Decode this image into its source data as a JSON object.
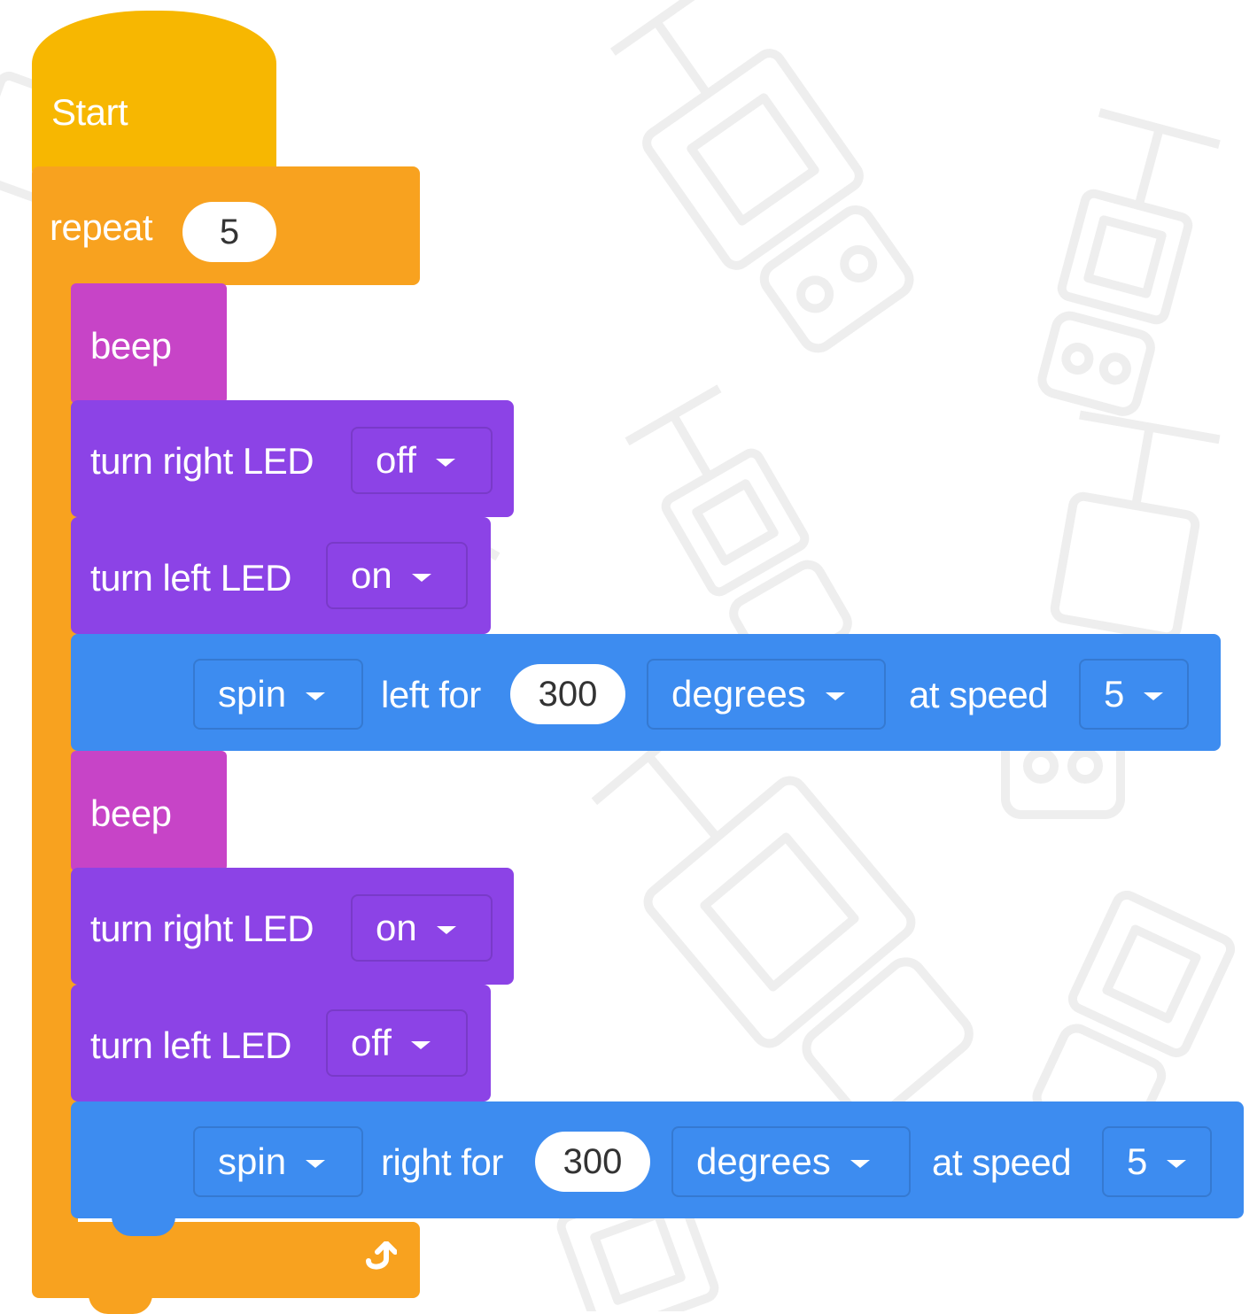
{
  "start": {
    "label": "Start"
  },
  "repeat": {
    "label": "repeat",
    "count": "5",
    "loop_icon": "repeat-arrow-icon"
  },
  "body": [
    {
      "kind": "beep",
      "label": "beep"
    },
    {
      "kind": "led",
      "label": "turn right LED",
      "value": "off"
    },
    {
      "kind": "led",
      "label": "turn left LED",
      "value": "on"
    },
    {
      "kind": "spin",
      "mode": "spin",
      "direction_label": "left for",
      "amount": "300",
      "unit": "degrees",
      "speed_label": "at speed",
      "speed": "5"
    },
    {
      "kind": "beep",
      "label": "beep"
    },
    {
      "kind": "led",
      "label": "turn right LED",
      "value": "on"
    },
    {
      "kind": "led",
      "label": "turn left LED",
      "value": "off"
    },
    {
      "kind": "spin",
      "mode": "spin",
      "direction_label": "right for",
      "amount": "300",
      "unit": "degrees",
      "speed_label": "at speed",
      "speed": "5"
    }
  ],
  "colors": {
    "event": "#F7B701",
    "control": "#F8A21F",
    "sound": "#C744C7",
    "looks": "#8C43E6",
    "motion": "#3D8CF0",
    "background_pattern": "#EEEEEE"
  },
  "icons": {
    "background": "robot-pattern-icon",
    "dropdown": "dropdown-caret-icon"
  }
}
